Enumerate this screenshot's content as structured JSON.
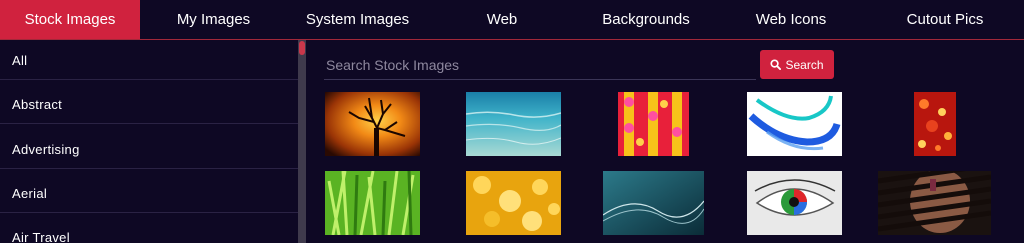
{
  "tabs": [
    {
      "label": "Stock Images",
      "active": true
    },
    {
      "label": "My Images",
      "active": false
    },
    {
      "label": "System Images",
      "active": false
    },
    {
      "label": "Web",
      "active": false
    },
    {
      "label": "Backgrounds",
      "active": false
    },
    {
      "label": "Web Icons",
      "active": false
    },
    {
      "label": "Cutout Pics",
      "active": false
    }
  ],
  "sidebar": {
    "items": [
      {
        "label": "All"
      },
      {
        "label": "Abstract"
      },
      {
        "label": "Advertising"
      },
      {
        "label": "Aerial"
      },
      {
        "label": "Air Travel"
      }
    ]
  },
  "search": {
    "placeholder": "Search Stock Images",
    "value": "",
    "button_label": "Search"
  },
  "thumbnails": [
    {
      "subject": "tree silhouette at sunset"
    },
    {
      "subject": "ocean water"
    },
    {
      "subject": "red yellow bokeh pattern"
    },
    {
      "subject": "blue abstract wave"
    },
    {
      "subject": "red bokeh lights"
    },
    {
      "subject": "green grass"
    },
    {
      "subject": "golden bokeh"
    },
    {
      "subject": "teal abstract waves"
    },
    {
      "subject": "close-up eye"
    },
    {
      "subject": "woman behind blinds"
    }
  ],
  "colors": {
    "accent": "#d0223e",
    "background": "#0e0824"
  }
}
